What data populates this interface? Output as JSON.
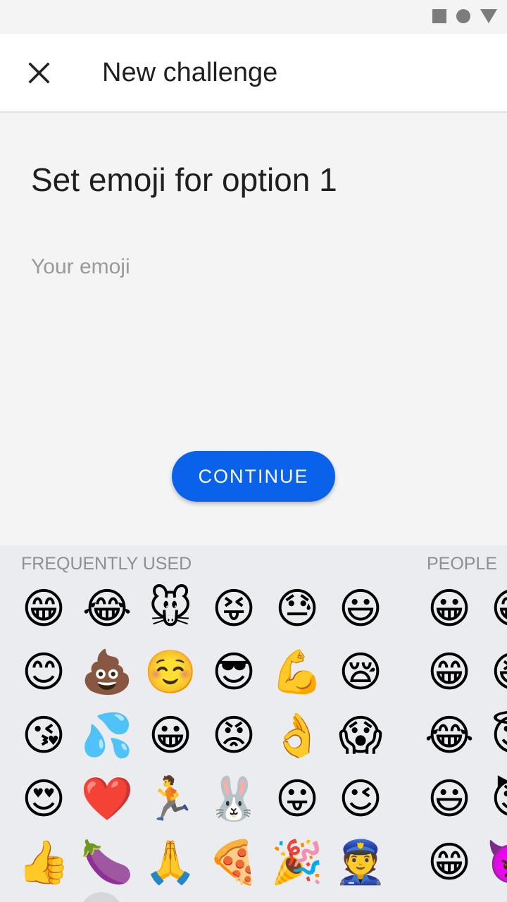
{
  "header": {
    "title": "New challenge"
  },
  "content": {
    "heading": "Set emoji for option 1",
    "input_placeholder": "Your emoji",
    "input_value": ""
  },
  "buttons": {
    "continue": "CONTINUE"
  },
  "emoji_keyboard": {
    "frequently_used_label": "FREQUENTLY USED",
    "people_label": "PEOPLE",
    "frequently_used": [
      "😁",
      "😂",
      "🐭",
      "😝",
      "😓",
      "😃",
      "😊",
      "💩",
      "☺️",
      "😎",
      "💪",
      "😪",
      "😘",
      "💦",
      "😀",
      "😡",
      "👌",
      "😱",
      "😍",
      "❤️",
      "🏃",
      "🐰",
      "😛",
      "😉",
      "👍",
      "🍆",
      "🙏",
      "🍕",
      "🎉",
      "👮"
    ],
    "people": [
      "😀",
      "😁",
      "😁",
      "😆",
      "😂",
      "😇",
      "😃",
      "😈",
      "😁",
      "👿"
    ]
  },
  "colors": {
    "accent": "#0a62eb",
    "keyboard_bg": "#eaecef",
    "background": "#f4f4f5"
  },
  "icons": {
    "close": "close-icon",
    "status": [
      "stop-square-icon",
      "home-circle-icon",
      "back-triangle-icon"
    ]
  }
}
